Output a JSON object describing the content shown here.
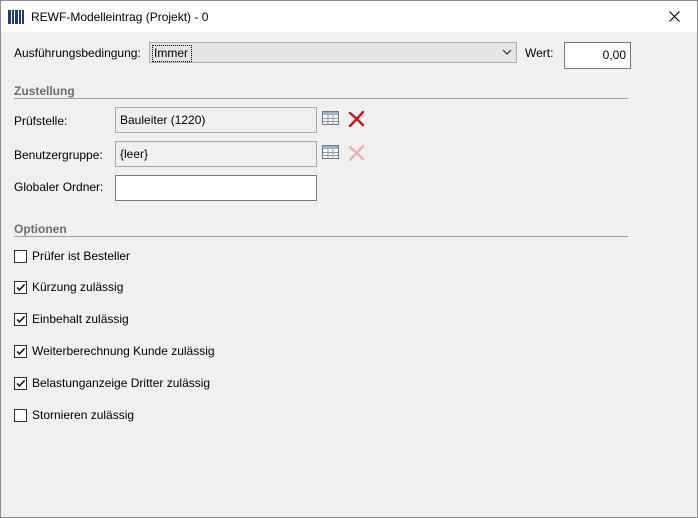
{
  "window": {
    "title": "REWF-Modelleintrag (Projekt) - 0"
  },
  "condition": {
    "label": "Ausführungsbedingung:",
    "value": "Immer"
  },
  "value_field": {
    "label": "Wert:",
    "value": "0,00"
  },
  "zustellung": {
    "title": "Zustellung",
    "pruefstelle": {
      "label": "Prüfstelle:",
      "value": "Bauleiter (1220)"
    },
    "benutzergruppe": {
      "label": "Benutzergruppe:",
      "value": "{leer}"
    },
    "globaler_ordner": {
      "label": "Globaler Ordner:",
      "value": ""
    }
  },
  "optionen": {
    "title": "Optionen",
    "items": [
      {
        "label": "Prüfer ist Besteller",
        "checked": false
      },
      {
        "label": "Kürzung zulässig",
        "checked": true
      },
      {
        "label": "Einbehalt zulässig",
        "checked": true
      },
      {
        "label": "Weiterberechnung Kunde zulässig",
        "checked": true
      },
      {
        "label": "Belastunganzeige Dritter zulässig",
        "checked": true
      },
      {
        "label": "Stornieren zulässig",
        "checked": false
      }
    ]
  },
  "icons": {
    "app": "app-icon",
    "close": "close-icon",
    "lookup": "table-icon",
    "remove": "delete-x-icon"
  },
  "colors": {
    "remove_active": "#d01010",
    "remove_disabled": "#e7b0b0"
  }
}
